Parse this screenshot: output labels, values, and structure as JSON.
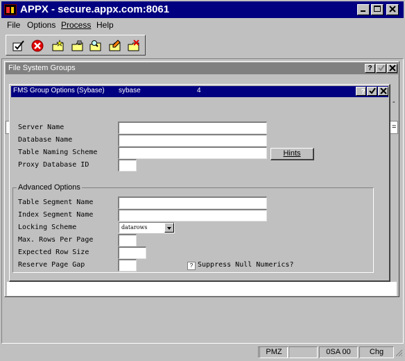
{
  "window": {
    "title": "APPX - secure.appx.com:8061"
  },
  "menu": {
    "file": "File",
    "options": "Options",
    "process": "Process",
    "help": "Help"
  },
  "toolbar": [
    "ok-icon",
    "cancel-icon",
    "new-icon",
    "open-icon",
    "find-icon",
    "edit-icon",
    "delete-icon"
  ],
  "child_window": {
    "title": "File System Groups",
    "help_glyph": "?",
    "dash": "-",
    "eq": "="
  },
  "dialog": {
    "title": "FMS Group Options (Sybase)",
    "title_value": "sybase",
    "title_number": "4",
    "help_glyph": "?",
    "fields": {
      "server_name": {
        "label": "Server Name",
        "value": ""
      },
      "database_name": {
        "label": "Database Name",
        "value": ""
      },
      "table_naming_scheme": {
        "label": "Table Naming Scheme",
        "value": ""
      },
      "proxy_database_id": {
        "label": "Proxy Database ID",
        "value": ""
      }
    },
    "hints_button": "Hints",
    "advanced": {
      "group_label": "Advanced Options",
      "table_segment_name": {
        "label": "Table Segment Name",
        "value": ""
      },
      "index_segment_name": {
        "label": "Index Segment Name",
        "value": ""
      },
      "locking_scheme": {
        "label": "Locking Scheme",
        "value": "datarows"
      },
      "max_rows_per_page": {
        "label": "Max. Rows Per Page",
        "value": ""
      },
      "expected_row_size": {
        "label": "Expected Row Size",
        "value": ""
      },
      "reserve_page_gap": {
        "label": "Reserve Page Gap",
        "value": ""
      },
      "suppress_null_numerics": {
        "label": "Suppress Null Numerics?",
        "value": "?"
      }
    }
  },
  "status": {
    "cell1": "",
    "cell2": "PMZ",
    "cell3": "",
    "cell4": "0SA 00",
    "cell5": "Chg"
  },
  "colors": {
    "title_active": "#000080",
    "title_inactive": "#808080",
    "face": "#c0c0c0"
  }
}
